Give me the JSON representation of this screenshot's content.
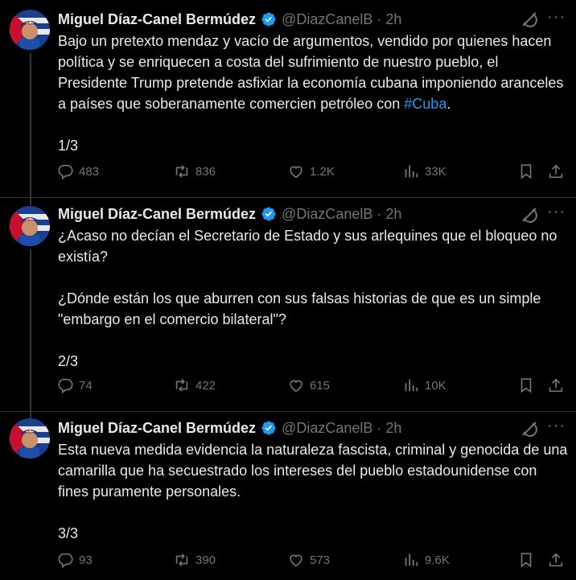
{
  "author": {
    "name": "Miguel Díaz-Canel Bermúdez",
    "handle": "@DiazCanelB",
    "separator": "·",
    "time": "2h"
  },
  "icons": {
    "verified": "verified-badge-icon",
    "grok": "grok-icon",
    "more": "more-options-icon",
    "reply": "reply-icon",
    "retweet": "retweet-icon",
    "like": "like-icon",
    "views": "views-icon",
    "bookmark": "bookmark-icon",
    "share": "share-icon"
  },
  "colors": {
    "background": "#000000",
    "text": "#e7e9ea",
    "muted": "#71767b",
    "link": "#1d9bf0",
    "verified": "#1d9bf0"
  },
  "tweets": [
    {
      "text_before": "Bajo un pretexto mendaz y vacío de argumentos, vendido por quienes hacen política y se enriquecen a costa del sufrimiento de nuestro pueblo, el Presidente Trump pretende asfixiar la economía cubana imponiendo aranceles a países que soberanamente comercien petróleo con ",
      "hashtag": "#Cuba",
      "text_after": ".",
      "counter": "1/3",
      "replies": "483",
      "retweets": "836",
      "likes": "1.2K",
      "views": "33K"
    },
    {
      "p1": "¿Acaso no decían el Secretario de Estado y sus arlequines que el bloqueo no existía?",
      "p2": "¿Dónde están los que aburren con sus falsas historias de que es un simple \"embargo en el comercio bilateral\"?",
      "counter": "2/3",
      "replies": "74",
      "retweets": "422",
      "likes": "615",
      "views": "10K"
    },
    {
      "p1": "Esta nueva medida evidencia la naturaleza fascista, criminal y genocida de una camarilla que ha secuestrado los intereses del pueblo estadounidense con fines puramente personales.",
      "counter": "3/3",
      "replies": "93",
      "retweets": "390",
      "likes": "573",
      "views": "9.6K"
    }
  ]
}
